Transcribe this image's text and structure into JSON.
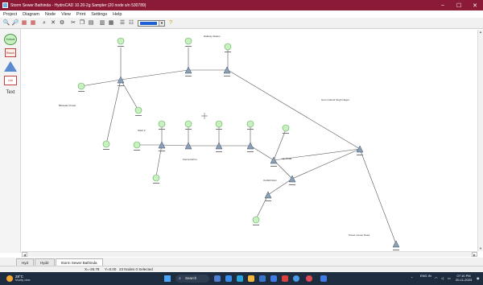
{
  "window": {
    "title": "Storm Sewer Bathinda - HydroCAD 10.20-2g Sampler (20 node s/n 530789)",
    "controls": {
      "minimize": "–",
      "maximize": "☐",
      "close": "✕"
    }
  },
  "menu": [
    "Project",
    "Diagram",
    "Node",
    "View",
    "Print",
    "Settings",
    "Help"
  ],
  "toolbar": {
    "icons": [
      "zoom-in-icon",
      "zoom-out-icon",
      "zoom-window-icon",
      "binoculars-icon",
      "delete-icon",
      "settings-icon",
      "cut-icon",
      "copy-icon",
      "paste-icon",
      "print-icon",
      "calculate-icon",
      "report-icon"
    ],
    "color_select_value": "blue",
    "help_icon": "help-icon"
  },
  "palette": {
    "subcat": "Subcat",
    "reach": "Reach",
    "pond": "Pond",
    "link": "Link",
    "text": "Text"
  },
  "diagram": {
    "labels": {
      "top": "Railway Station",
      "left": "Bibiwala Chowk",
      "middle": "Ward 3",
      "lower_middle": "Kamla Nehru",
      "right_upper": "Guru Gobind Singh Nagar",
      "right_lower": "Ajit Road",
      "bottom_right": "Power House Road",
      "bottom_right_2": "Outfall Drain"
    },
    "colors": {
      "subcat": "#c9f1bf",
      "subcat_stroke": "#59a85a",
      "pond": "#8aa0b8",
      "pipe": "#4a4a4a"
    }
  },
  "tabs": [
    "Hyd",
    "Hyd2",
    "Storm Sewer Bathinda"
  ],
  "active_tab": 2,
  "status": {
    "x": "X=-25.78",
    "y": "Y=0.00",
    "selection": "23 Nodes 0 Selected"
  },
  "taskbar": {
    "weather_temp": "28°C",
    "weather_cond": "Mostly clear",
    "search": "Search",
    "lang": "ENG\nIN",
    "time": "07:10 PM",
    "date": "20-11-2023"
  }
}
